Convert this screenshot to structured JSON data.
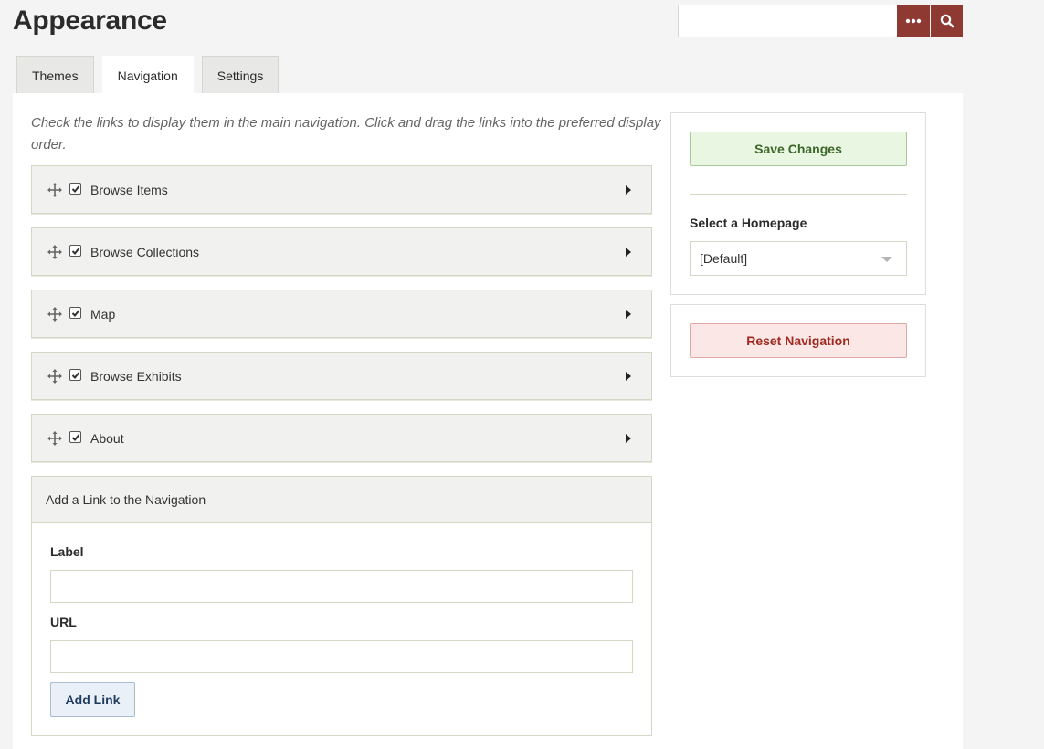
{
  "page": {
    "title": "Appearance"
  },
  "search": {
    "value": "",
    "more_label": "•••"
  },
  "tabs": [
    {
      "label": "Themes"
    },
    {
      "label": "Navigation",
      "active": true
    },
    {
      "label": "Settings"
    }
  ],
  "navigation": {
    "intro": "Check the links to display them in the main navigation. Click and drag the links into the preferred display order.",
    "items": [
      {
        "label": "Browse Items",
        "checked": true
      },
      {
        "label": "Browse Collections",
        "checked": true
      },
      {
        "label": "Map",
        "checked": true
      },
      {
        "label": "Browse Exhibits",
        "checked": true
      },
      {
        "label": "About",
        "checked": true
      }
    ]
  },
  "add_link": {
    "heading": "Add a Link to the Navigation",
    "label_field": {
      "label": "Label",
      "value": ""
    },
    "url_field": {
      "label": "URL",
      "value": ""
    },
    "button": "Add Link"
  },
  "sidebar": {
    "save_button": "Save Changes",
    "homepage_label": "Select a Homepage",
    "homepage_selected": "[Default]",
    "reset_button": "Reset Navigation"
  },
  "colors": {
    "brand": "#8e3a33",
    "save_bg": "#e9f6e2",
    "reset_bg": "#fbe7e6",
    "add_bg": "#e9f0f8"
  }
}
